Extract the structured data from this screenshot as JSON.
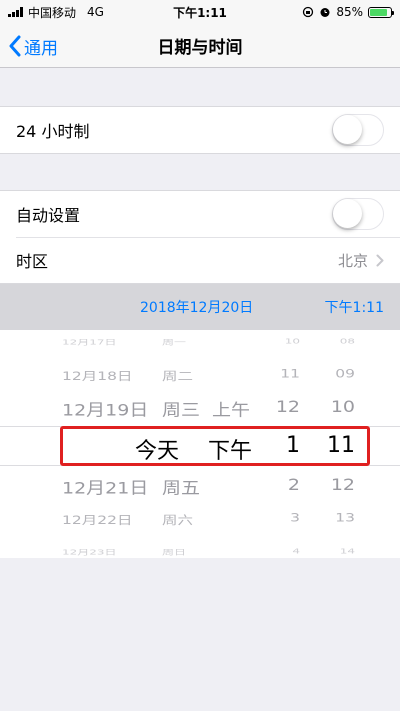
{
  "status_bar": {
    "carrier": "中国移动",
    "network": "4G",
    "time": "下午1:11",
    "battery_percent": "85%",
    "battery_level": 0.85
  },
  "nav": {
    "back_label": "通用",
    "title": "日期与时间"
  },
  "settings": {
    "hour24_label": "24 小时制",
    "hour24_on": false,
    "auto_label": "自动设置",
    "auto_on": false,
    "timezone_label": "时区",
    "timezone_value": "北京"
  },
  "date_header": {
    "date": "2018年12月20日",
    "time": "下午1:11"
  },
  "picker": {
    "rows": [
      {
        "date": "12月17日",
        "weekday": "周一",
        "ampm": "",
        "hour": "10",
        "minute": "08"
      },
      {
        "date": "12月18日",
        "weekday": "周二",
        "ampm": "",
        "hour": "11",
        "minute": "09"
      },
      {
        "date": "12月19日",
        "weekday": "周三",
        "ampm": "上午",
        "hour": "12",
        "minute": "10"
      },
      {
        "date": "",
        "weekday": "今天",
        "ampm": "下午",
        "hour": "1",
        "minute": "11"
      },
      {
        "date": "12月21日",
        "weekday": "周五",
        "ampm": "",
        "hour": "2",
        "minute": "12"
      },
      {
        "date": "12月22日",
        "weekday": "周六",
        "ampm": "",
        "hour": "3",
        "minute": "13"
      },
      {
        "date": "12月23日",
        "weekday": "周日",
        "ampm": "",
        "hour": "4",
        "minute": "14"
      }
    ],
    "selected_index": 3
  },
  "colors": {
    "accent": "#007aff",
    "highlight": "#e02020",
    "toggle_off_border": "#e5e5ea"
  }
}
